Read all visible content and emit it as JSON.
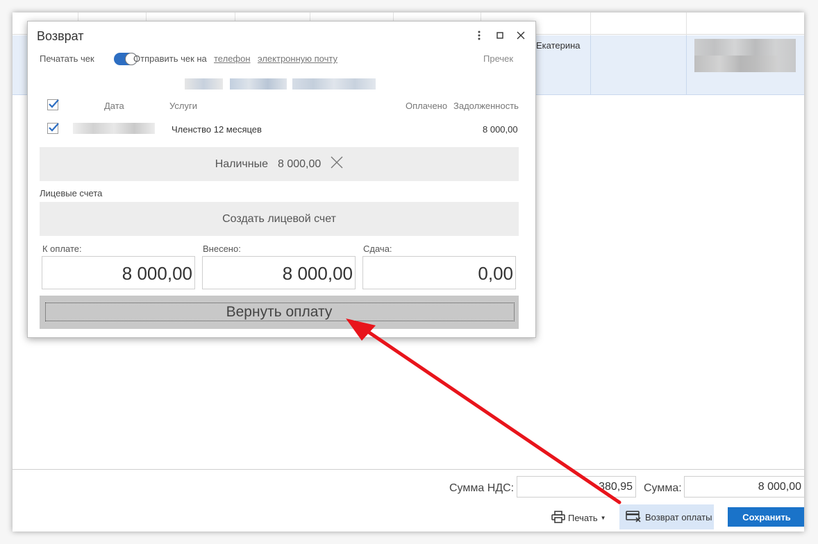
{
  "background": {
    "person_name": "Екатерина",
    "footer": {
      "vat_label": "Сумма НДС:",
      "vat_value": "380,95",
      "sum_label": "Сумма:",
      "sum_value": "8 000,00",
      "print_label": "Печать",
      "refund_label": "Возврат оплаты",
      "save_label": "Сохранить"
    }
  },
  "dialog": {
    "title": "Возврат",
    "print_receipt_label": "Печатать чек",
    "print_receipt_on": true,
    "send_receipt_label": "Отправить чек на",
    "phone_link": "телефон",
    "email_link": "электронную почту",
    "precheck_label": "Пречек",
    "table": {
      "columns": [
        "Дата",
        "Услуги",
        "Оплачено",
        "Задолженность"
      ],
      "header_checked": true,
      "rows": [
        {
          "checked": true,
          "service": "Членство 12 месяцев",
          "debt": "8 000,00"
        }
      ]
    },
    "payment": {
      "method": "Наличные",
      "amount": "8 000,00"
    },
    "accounts_label": "Лицевые счета",
    "create_account_label": "Создать лицевой счет",
    "to_pay_label": "К оплате:",
    "to_pay_value": "8 000,00",
    "paid_in_label": "Внесено:",
    "paid_in_value": "8 000,00",
    "change_label": "Сдача:",
    "change_value": "0,00",
    "refund_button_label": "Вернуть оплату"
  },
  "colors": {
    "accent": "#1a73c9",
    "toggle": "#2d6ec2",
    "annotation_arrow": "#e8141b",
    "selected_row": "#e6eef9"
  }
}
